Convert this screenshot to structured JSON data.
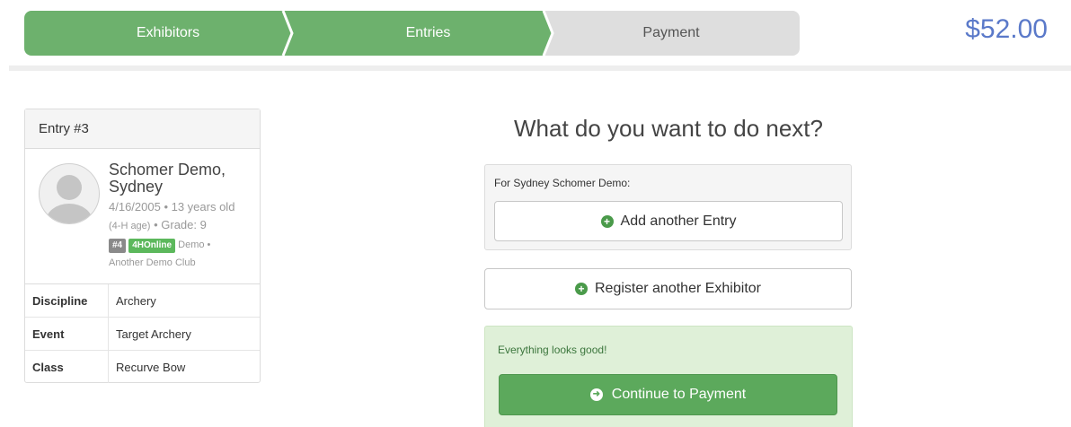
{
  "steps": {
    "exhibitors": "Exhibitors",
    "entries": "Entries",
    "payment": "Payment"
  },
  "total": "$52.00",
  "entry_card": {
    "title": "Entry #3",
    "name": "Schomer Demo, Sydney",
    "dob": "4/16/2005 • 13 years old",
    "age_note": "(4-H age)",
    "grade": "• Grade: 9",
    "badge_number": "#4",
    "badge_source": "4HOnline",
    "club_prefix": "Demo •",
    "club": "Another Demo Club",
    "details": [
      {
        "label": "Discipline",
        "value": "Archery"
      },
      {
        "label": "Event",
        "value": "Target Archery"
      },
      {
        "label": "Class",
        "value": "Recurve Bow"
      }
    ]
  },
  "next": {
    "heading": "What do you want to do next?",
    "for_label": "For Sydney Schomer Demo:",
    "add_entry": "Add another Entry",
    "register_exhibitor": "Register another Exhibitor",
    "status": "Everything looks good!",
    "continue": "Continue to Payment"
  },
  "colors": {
    "step_active": "#6db16d",
    "step_inactive": "#dedede",
    "total": "#5a79c9",
    "success_bg": "#dff0d8",
    "primary_button": "#5ca95c"
  },
  "icons": {
    "add": "plus-circle-icon",
    "continue": "arrow-circle-right-icon",
    "avatar": "user-placeholder-icon"
  }
}
